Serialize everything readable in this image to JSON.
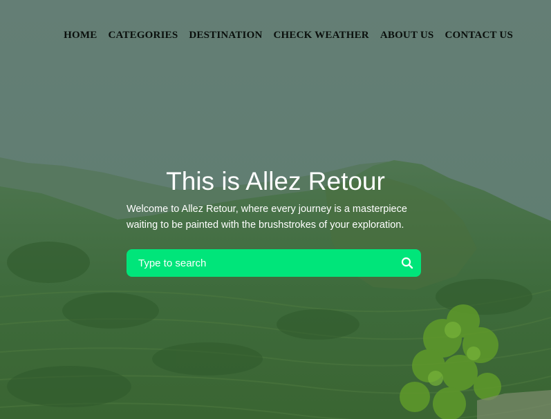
{
  "nav": {
    "items": [
      {
        "label": "HOME"
      },
      {
        "label": "CATEGORIES"
      },
      {
        "label": "DESTINATION"
      },
      {
        "label": "CHECK WEATHER"
      },
      {
        "label": "ABOUT US"
      },
      {
        "label": "CONTACT US"
      }
    ]
  },
  "hero": {
    "title": "This is Allez Retour",
    "subtitle": "Welcome to Allez Retour, where every journey is a masterpiece waiting to be painted with the brushstrokes of your exploration."
  },
  "search": {
    "placeholder": "Type to search",
    "value": "",
    "icon": "search-icon"
  },
  "colors": {
    "overlay": "#5e7d72",
    "search_bg": "#00e57a",
    "nav_text": "#0a0f0c",
    "hero_text": "#ffffff"
  }
}
